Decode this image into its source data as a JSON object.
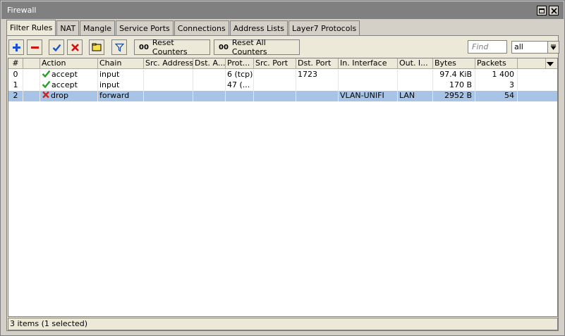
{
  "window": {
    "title": "Firewall"
  },
  "tabs": [
    {
      "label": "Filter Rules",
      "active": true
    },
    {
      "label": "NAT"
    },
    {
      "label": "Mangle"
    },
    {
      "label": "Service Ports"
    },
    {
      "label": "Connections"
    },
    {
      "label": "Address Lists"
    },
    {
      "label": "Layer7 Protocols"
    }
  ],
  "toolbar": {
    "add_icon": "plus-icon",
    "remove_icon": "minus-icon",
    "enable_icon": "check-icon",
    "disable_icon": "x-icon",
    "comment_icon": "note-icon",
    "filter_icon": "filter-icon",
    "oo": "00",
    "reset_counters": "Reset Counters",
    "reset_all_counters": "Reset All Counters",
    "find_placeholder": "Find",
    "select_value": "all"
  },
  "columns": [
    "#",
    "",
    "Action",
    "Chain",
    "Src. Address",
    "Dst. A...",
    "Prot...",
    "Src. Port",
    "Dst. Port",
    "In. Interface",
    "Out. I...",
    "Bytes",
    "Packets"
  ],
  "rows": [
    {
      "num": "0",
      "flag": "",
      "action": "accept",
      "action_icon": "check-icon",
      "chain": "input",
      "src_address": "",
      "dst_address": "",
      "protocol": "6 (tcp)",
      "src_port": "",
      "dst_port": "1723",
      "in_interface": "",
      "out_interface": "",
      "bytes": "97.4 KiB",
      "packets": "1 400",
      "selected": false
    },
    {
      "num": "1",
      "flag": "",
      "action": "accept",
      "action_icon": "check-icon",
      "chain": "input",
      "src_address": "",
      "dst_address": "",
      "protocol": "47 (...",
      "src_port": "",
      "dst_port": "",
      "in_interface": "",
      "out_interface": "",
      "bytes": "170 B",
      "packets": "3",
      "selected": false
    },
    {
      "num": "2",
      "flag": "",
      "action": "drop",
      "action_icon": "x-icon",
      "chain": "forward",
      "src_address": "",
      "dst_address": "",
      "protocol": "",
      "src_port": "",
      "dst_port": "",
      "in_interface": "VLAN-UNIFI",
      "out_interface": "LAN",
      "bytes": "2952 B",
      "packets": "54",
      "selected": true
    }
  ],
  "status": "3 items (1 selected)",
  "colors": {
    "accent_plus": "#1f4fd1",
    "accent_minus": "#cc1111",
    "check": "#2a9d2a",
    "drop": "#cc2222",
    "selected_row": "#a7c4e6"
  }
}
